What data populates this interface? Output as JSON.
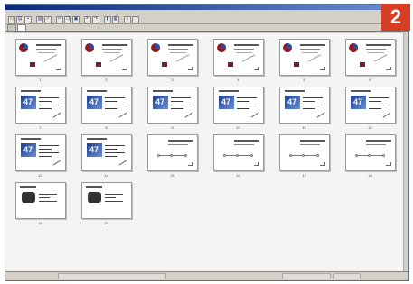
{
  "window": {
    "title": "",
    "menus": [
      "",
      "",
      "",
      "",
      "",
      "",
      ""
    ]
  },
  "tabs": [
    {
      "label": "",
      "active": false
    },
    {
      "label": "",
      "active": true
    }
  ],
  "badge": "2",
  "slides": [
    {
      "n": "1",
      "label": "",
      "kind": "pie"
    },
    {
      "n": "2",
      "label": "",
      "kind": "pie"
    },
    {
      "n": "3",
      "label": "",
      "kind": "pie"
    },
    {
      "n": "4",
      "label": "",
      "kind": "pie"
    },
    {
      "n": "5",
      "label": "",
      "kind": "pie"
    },
    {
      "n": "6",
      "label": "",
      "kind": "pie"
    },
    {
      "n": "7",
      "label": "",
      "kind": "numbered"
    },
    {
      "n": "8",
      "label": "",
      "kind": "numbered"
    },
    {
      "n": "9",
      "label": "",
      "kind": "numbered"
    },
    {
      "n": "10",
      "label": "",
      "kind": "numbered"
    },
    {
      "n": "11",
      "label": "",
      "kind": "numbered"
    },
    {
      "n": "12",
      "label": "",
      "kind": "numbered"
    },
    {
      "n": "13",
      "label": "",
      "kind": "numbered"
    },
    {
      "n": "14",
      "label": "",
      "kind": "numbered"
    },
    {
      "n": "15",
      "label": "",
      "kind": "flow"
    },
    {
      "n": "16",
      "label": "",
      "kind": "flow"
    },
    {
      "n": "17",
      "label": "",
      "kind": "flow"
    },
    {
      "n": "18",
      "label": "",
      "kind": "flow"
    },
    {
      "n": "19",
      "label": "",
      "kind": "camera"
    },
    {
      "n": "20",
      "label": "",
      "kind": "camera"
    }
  ],
  "status": [
    "",
    "",
    ""
  ],
  "colors": {
    "badge": "#d73e25",
    "title_bar": "#0a2a7a",
    "box_blue": "#1e3f8c"
  }
}
